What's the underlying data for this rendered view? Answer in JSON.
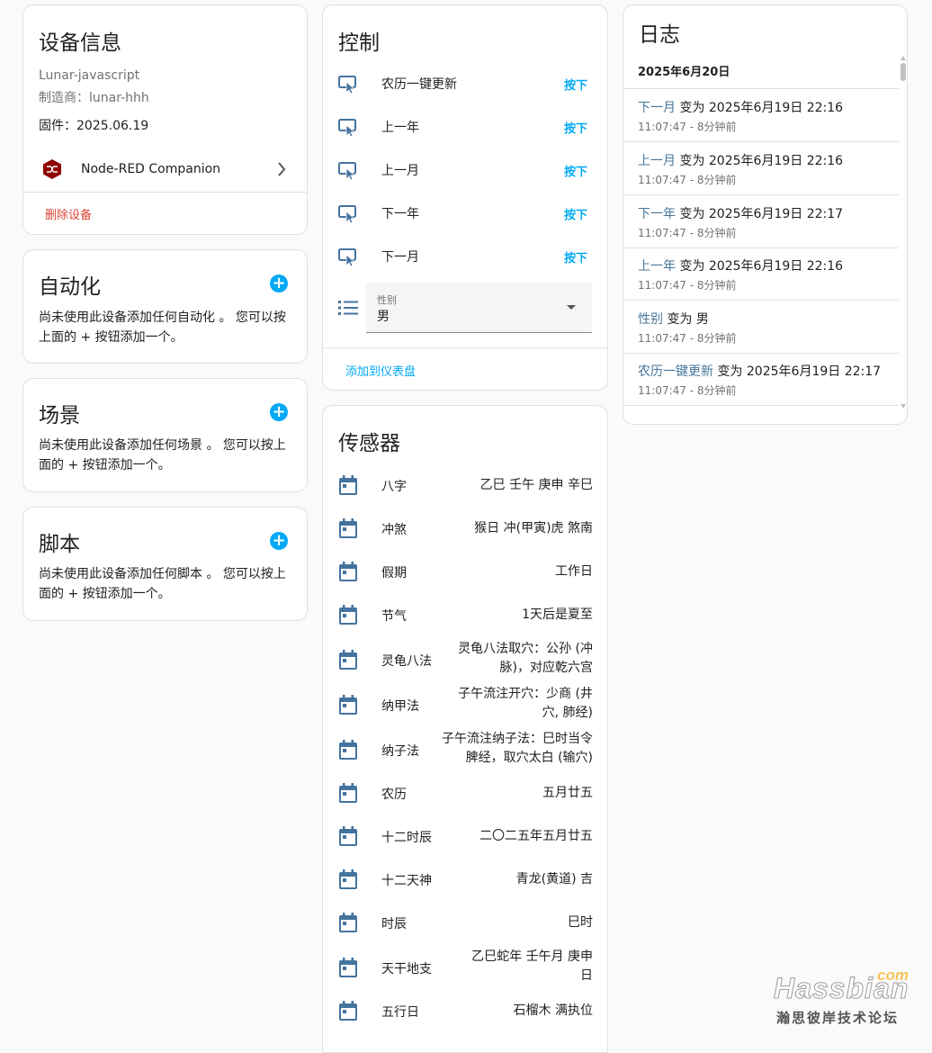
{
  "device_info": {
    "title": "设备信息",
    "model": "Lunar-javascript",
    "manufacturer": "制造商：lunar-hhh",
    "firmware": "固件：2025.06.19",
    "integration_name": "Node-RED Companion",
    "delete_label": "删除设备"
  },
  "automation": {
    "title": "自动化",
    "description_line1": "尚未使用此设备添加任何自动化 。 您可以按",
    "description_line2": "上面的 + 按钮添加一个。"
  },
  "scenes": {
    "title": "场景",
    "description_line1": "尚未使用此设备添加任何场景 。 您可以按上",
    "description_line2": "面的 + 按钮添加一个。"
  },
  "scripts": {
    "title": "脚本",
    "description_line1": "尚未使用此设备添加任何脚本 。 您可以按上",
    "description_line2": "面的 + 按钮添加一个。"
  },
  "controls": {
    "title": "控制",
    "buttons": [
      {
        "label": "农历一键更新",
        "action": "按下"
      },
      {
        "label": "上一年",
        "action": "按下"
      },
      {
        "label": "上一月",
        "action": "按下"
      },
      {
        "label": "下一年",
        "action": "按下"
      },
      {
        "label": "下一月",
        "action": "按下"
      }
    ],
    "select": {
      "label": "性别",
      "value": "男"
    },
    "add_to_dashboard": "添加到仪表盘"
  },
  "sensors": {
    "title": "传感器",
    "items": [
      {
        "label": "八字",
        "value": "乙巳 壬午 庚申 辛巳"
      },
      {
        "label": "冲煞",
        "value": "猴日 冲(甲寅)虎 煞南"
      },
      {
        "label": "假期",
        "value": "工作日"
      },
      {
        "label": "节气",
        "value": "1天后是夏至"
      },
      {
        "label": "灵龟八法",
        "value_line1": "灵龟八法取穴：公孙 (冲",
        "value_line2": "脉)，对应乾六宫"
      },
      {
        "label": "纳甲法",
        "value_line1": "子午流注开穴：少商 (井",
        "value_line2": "穴, 肺经)"
      },
      {
        "label": "纳子法",
        "value_line1": "子午流注纳子法：巳时当令",
        "value_line2": "脾经，取穴太白 (输穴)"
      },
      {
        "label": "农历",
        "value": "五月廿五"
      },
      {
        "label": "十二时辰",
        "value": "二〇二五年五月廿五"
      },
      {
        "label": "十二天神",
        "value": "青龙(黄道) 吉"
      },
      {
        "label": "时辰",
        "value": "巳时"
      },
      {
        "label": "天干地支",
        "value_line1": "乙巳蛇年 壬午月 庚申",
        "value_line2": "日"
      },
      {
        "label": "五行日",
        "value": "石榴木 满执位"
      }
    ]
  },
  "logbook": {
    "title": "日志",
    "date": "2025年6月20日",
    "entries": [
      {
        "entity": "下一月",
        "text": "变为 2025年6月19日 22:16",
        "time": "11:07:47 - 8分钟前"
      },
      {
        "entity": "上一月",
        "text": "变为 2025年6月19日 22:16",
        "time": "11:07:47 - 8分钟前"
      },
      {
        "entity": "下一年",
        "text": "变为 2025年6月19日 22:17",
        "time": "11:07:47 - 8分钟前"
      },
      {
        "entity": "上一年",
        "text": "变为 2025年6月19日 22:16",
        "time": "11:07:47 - 8分钟前"
      },
      {
        "entity": "性别",
        "text": "变为 男",
        "time": "11:07:47 - 8分钟前"
      },
      {
        "entity": "农历一键更新",
        "text": "变为 2025年6月19日 22:17",
        "time": "11:07:47 - 8分钟前"
      }
    ]
  },
  "watermark": {
    "brand": "Hassbian",
    "suffix": "com",
    "tagline": "瀚思彼岸技术论坛"
  },
  "colors": {
    "accent": "#03a9f4",
    "icon": "#44739e",
    "danger": "#db4437",
    "integration_logo": "#8f0000"
  },
  "icons": {
    "control_button": "gesture-tap-button-icon",
    "select": "format-list-bulleted-icon",
    "sensor": "calendar-icon",
    "add": "plus-circle-icon",
    "chevron": "chevron-right-icon",
    "dropdown": "menu-down-icon"
  }
}
